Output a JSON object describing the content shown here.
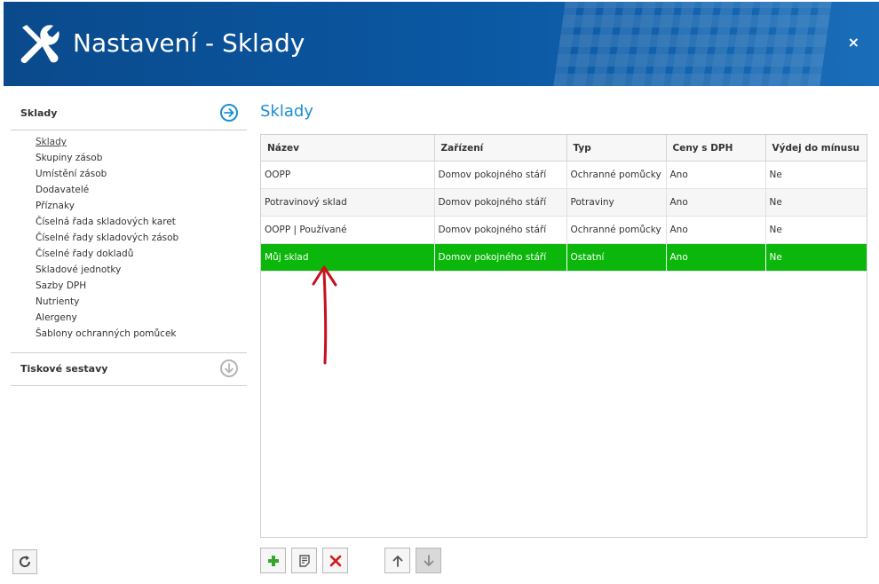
{
  "window": {
    "title": "Nastavení - Sklady",
    "close_glyph": "×",
    "header_color": "#0b58a3"
  },
  "sidebar": {
    "sections": [
      {
        "label": "Sklady",
        "expanded": true,
        "icon": "arrow-right-circle-icon",
        "items": [
          {
            "label": "Sklady",
            "active": true
          },
          {
            "label": "Skupiny zásob"
          },
          {
            "label": "Umístění zásob"
          },
          {
            "label": "Dodavatelé"
          },
          {
            "label": "Příznaky"
          },
          {
            "label": "Číselná řada skladových karet"
          },
          {
            "label": "Číselné řady skladových zásob"
          },
          {
            "label": "Číselné řady dokladů"
          },
          {
            "label": "Skladové jednotky"
          },
          {
            "label": "Sazby DPH"
          },
          {
            "label": "Nutrienty"
          },
          {
            "label": "Alergeny"
          },
          {
            "label": "Šablony ochranných pomůcek"
          }
        ]
      },
      {
        "label": "Tiskové sestavy",
        "expanded": false,
        "icon": "arrow-down-circle-icon"
      }
    ]
  },
  "main": {
    "title": "Sklady",
    "accent_color": "#1a8ed6",
    "table": {
      "columns": [
        "Název",
        "Zařízení",
        "Typ",
        "Ceny s DPH",
        "Výdej do mínusu"
      ],
      "rows": [
        [
          "OOPP",
          "Domov pokojného stáří",
          "Ochranné pomůcky",
          "Ano",
          "Ne"
        ],
        [
          "Potravinový sklad",
          "Domov pokojného stáří",
          "Potraviny",
          "Ano",
          "Ne"
        ],
        [
          "OOPP | Používané",
          "Domov pokojného stáří",
          "Ochranné pomůcky",
          "Ano",
          "Ne"
        ],
        [
          "Můj sklad",
          "Domov pokojného stáří",
          "Ostatní",
          "Ano",
          "Ne"
        ]
      ],
      "selected_row": 3,
      "selected_color": "#0ab70a"
    },
    "toolbar": [
      {
        "icon": "plus-icon",
        "action": "add"
      },
      {
        "icon": "edit-note-icon",
        "action": "edit"
      },
      {
        "icon": "delete-x-icon",
        "action": "delete"
      },
      {
        "icon": "arrow-up-icon",
        "action": "move-up"
      },
      {
        "icon": "arrow-down-icon",
        "action": "move-down",
        "disabled": true
      }
    ]
  },
  "annotation": {
    "type": "red-arrow",
    "points_to": "Můj sklad",
    "color": "#c8101e"
  },
  "footer": {
    "refresh_icon": "refresh-icon"
  }
}
